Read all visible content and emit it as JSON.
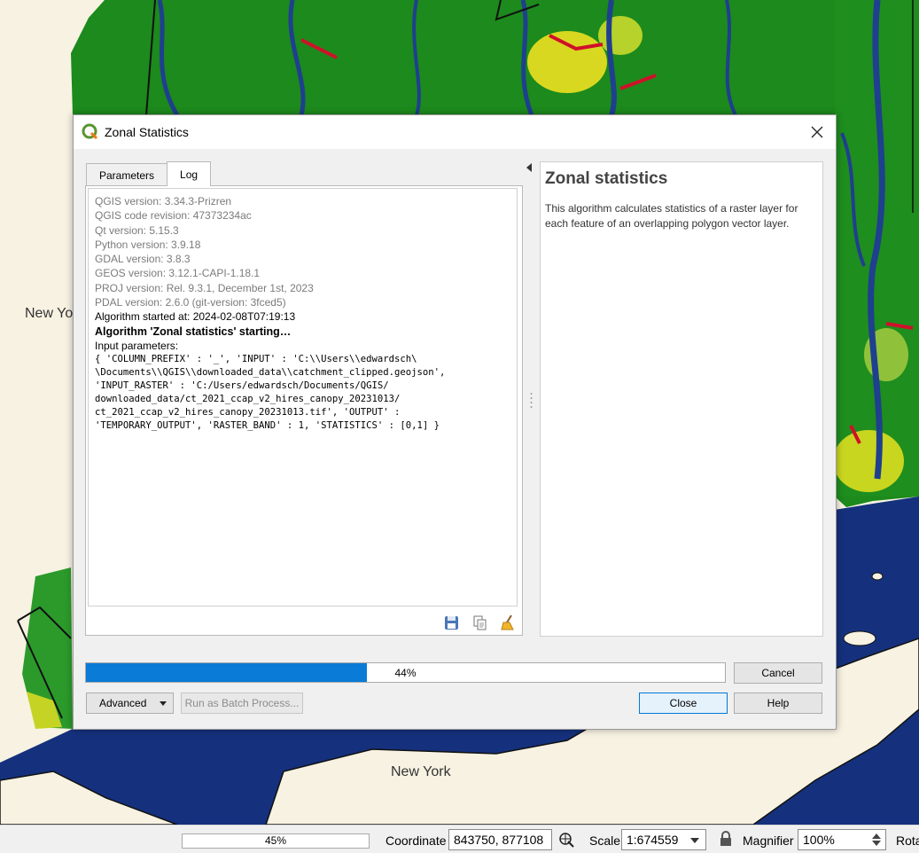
{
  "map": {
    "labels": [
      "New Yo",
      "New York"
    ]
  },
  "dialog": {
    "title": "Zonal Statistics",
    "tabs": [
      {
        "label": "Parameters",
        "active": false
      },
      {
        "label": "Log",
        "active": true
      }
    ],
    "log": {
      "version_lines": [
        "QGIS version: 3.34.3-Prizren",
        "QGIS code revision: 47373234ac",
        "Qt version: 5.15.3",
        "Python version: 3.9.18",
        "GDAL version: 3.8.3",
        "GEOS version: 3.12.1-CAPI-1.18.1",
        "PROJ version: Rel. 9.3.1, December 1st, 2023",
        "PDAL version: 2.6.0 (git-version: 3fced5)"
      ],
      "started": "Algorithm started at: 2024-02-08T07:19:13",
      "starting": "Algorithm 'Zonal statistics' starting…",
      "input_header": "Input parameters:",
      "param_lines": [
        "{ 'COLUMN_PREFIX' : '_', 'INPUT' : 'C:\\\\Users\\\\edwardsch\\",
        "\\Documents\\\\QGIS\\\\downloaded_data\\\\catchment_clipped.geojson',",
        "'INPUT_RASTER' : 'C:/Users/edwardsch/Documents/QGIS/",
        "downloaded_data/ct_2021_ccap_v2_hires_canopy_20231013/",
        "ct_2021_ccap_v2_hires_canopy_20231013.tif', 'OUTPUT' :",
        "'TEMPORARY_OUTPUT', 'RASTER_BAND' : 1, 'STATISTICS' : [0,1] }"
      ]
    },
    "help": {
      "title": "Zonal statistics",
      "body": "This algorithm calculates statistics of a raster layer for each feature of an overlapping polygon vector layer."
    },
    "progress": {
      "value": 0.44,
      "label": "44%"
    },
    "buttons": {
      "cancel": "Cancel",
      "advanced": "Advanced",
      "batch": "Run as Batch Process...",
      "close": "Close",
      "help": "Help"
    }
  },
  "statusbar": {
    "progress": {
      "value": 0.45,
      "label": "45%"
    },
    "coordinate_label": "Coordinate",
    "coordinate_value": "843750, 877108",
    "scale_label": "Scale",
    "scale_value": "1:674559",
    "magnifier_label": "Magnifier",
    "magnifier_value": "100%",
    "rotation_label": "Rota"
  },
  "colors": {
    "accent": "#0a7bd6",
    "forest": "#1c8a1c",
    "water": "#1f3f8f",
    "land": "#f7f2e2"
  }
}
